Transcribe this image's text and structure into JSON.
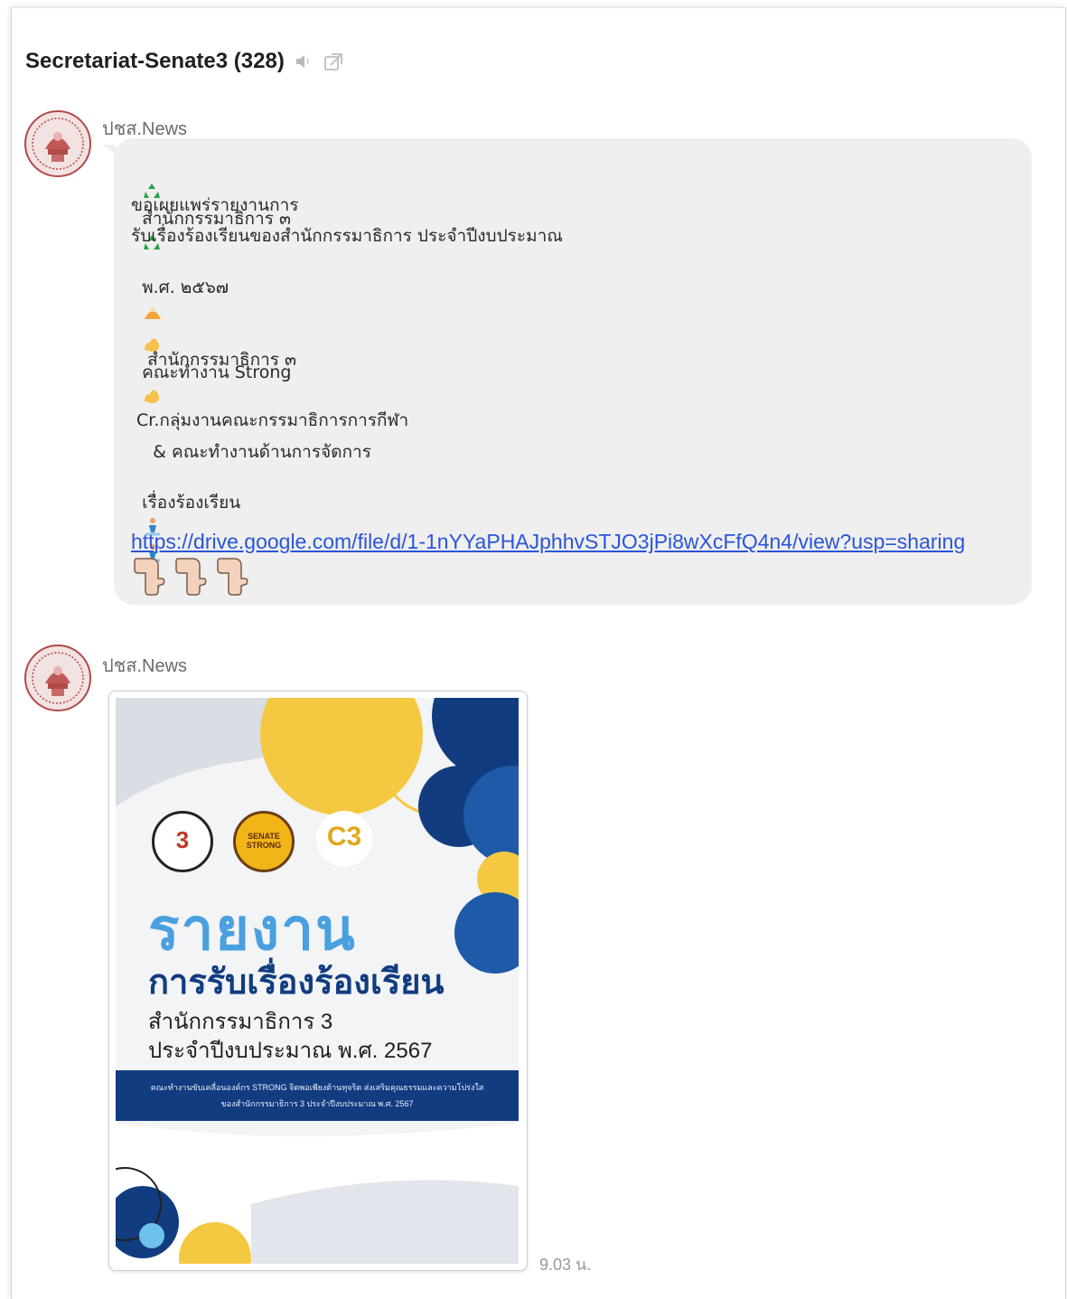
{
  "header": {
    "room_title": "Secretariat-Senate3 (328)",
    "mute_icon": "speaker-icon",
    "popout_icon": "external-window-icon"
  },
  "messages": [
    {
      "sender": "ปชส.News",
      "avatar_icon": "senate-emblem-avatar",
      "lines": [
        "สำนักกรรมาธิการ ๓",
        "ขอเผยแพร่รายงานการ",
        "รับเรื่องร้องเรียนของสำนักกรรมาธิการ ประจำปีงบประมาณ",
        "พ.ศ. ๒๕๖๗",
        "คณะทำงาน Strong",
        "   สำนักกรรมาธิการ ๓",
        " Cr.กลุ่มงานคณะกรรมาธิการการกีฬา",
        "    & คณะทำงานด้านการจัดการ",
        "เรื่องร้องเรียน"
      ],
      "link": "https://drive.google.com/file/d/1-1nYYaPHAJphhvSTJO3jPi8wXcFfQ4n4/view?usp=sharing",
      "emoji_icons": [
        "recycle-icon",
        "recycle-icon",
        "person-icon",
        "flexed-biceps-icon",
        "flexed-biceps-icon",
        "person-icon",
        "person-icon",
        "person-icon",
        "pointing-down-hand-icon",
        "pointing-down-hand-icon",
        "pointing-down-hand-icon"
      ]
    },
    {
      "sender": "ปชส.News",
      "avatar_icon": "senate-emblem-avatar",
      "image": {
        "logo1_text": "3",
        "logo2_text": "SENATE STRONG",
        "logo3_text": "C3",
        "title": "รายงาน",
        "subtitle": "การรับเรื่องร้องเรียน",
        "line2": "สำนักกรรมาธิการ 3",
        "line3": "ประจำปีงบประมาณ พ.ศ. 2567",
        "band_line1": "คณะทำงานขับเคลื่อนองค์กร STRONG จิตพอเพียงต้านทุจริต ส่งเสริมคุณธรรมและความโปร่งใส",
        "band_line2": "ของสำนักกรรมาธิการ 3 ประจำปีงบประมาณ พ.ศ. 2567"
      },
      "timestamp": "9.03 น."
    }
  ],
  "colors": {
    "bubble": "#efefef",
    "link": "#2a55d8",
    "poster_navy": "#123c80",
    "poster_blue": "#4aa0de",
    "poster_yellow": "#f5c842"
  }
}
